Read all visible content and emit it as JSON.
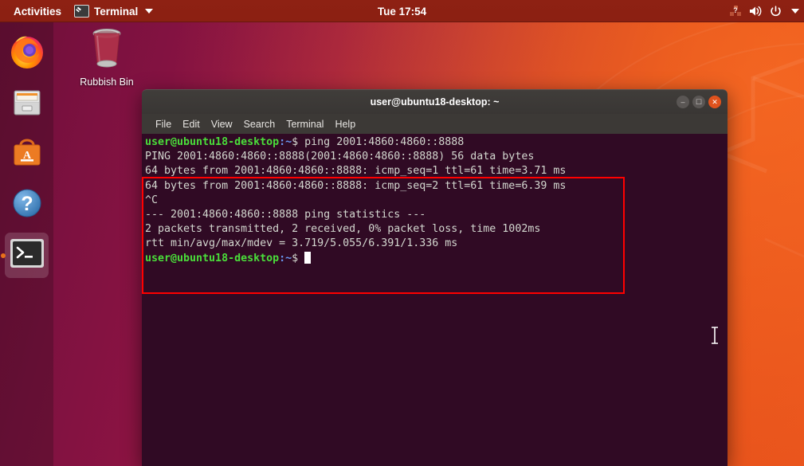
{
  "top_panel": {
    "activities_label": "Activities",
    "app_menu_label": "Terminal",
    "app_menu_icon": "terminal-icon",
    "clock": "Tue 17:54",
    "system_icons": [
      "keyboard-layout-icon",
      "volume-icon",
      "power-icon",
      "chevron-down-icon"
    ]
  },
  "dock": {
    "items": [
      {
        "name": "firefox",
        "label": "Firefox Web Browser",
        "active": false
      },
      {
        "name": "files",
        "label": "Files",
        "active": false
      },
      {
        "name": "ubuntu-software",
        "label": "Ubuntu Software",
        "active": false
      },
      {
        "name": "help",
        "label": "Help",
        "active": false
      },
      {
        "name": "terminal",
        "label": "Terminal",
        "active": true
      }
    ]
  },
  "desktop": {
    "icons": [
      {
        "name": "rubbish-bin",
        "label": "Rubbish Bin"
      }
    ]
  },
  "terminal_window": {
    "title": "user@ubuntu18-desktop: ~",
    "window_buttons": {
      "minimize": "–",
      "maximize": "☐",
      "close": "✕"
    },
    "menus": [
      "File",
      "Edit",
      "View",
      "Search",
      "Terminal",
      "Help"
    ],
    "prompt": {
      "user_host": "user@ubuntu18-desktop",
      "path": ":~",
      "symbol": "$"
    },
    "command": " ping 2001:4860:4860::8888",
    "output_lines": [
      "PING 2001:4860:4860::8888(2001:4860:4860::8888) 56 data bytes",
      "64 bytes from 2001:4860:4860::8888: icmp_seq=1 ttl=61 time=3.71 ms",
      "64 bytes from 2001:4860:4860::8888: icmp_seq=2 ttl=61 time=6.39 ms",
      "^C",
      "--- 2001:4860:4860::8888 ping statistics ---",
      "2 packets transmitted, 2 received, 0% packet loss, time 1002ms",
      "rtt min/avg/max/mdev = 3.719/5.055/6.391/1.336 ms"
    ]
  },
  "annotation": {
    "type": "rectangle",
    "color": "#ff0000"
  },
  "colors": {
    "terminal_bg": "#300a24",
    "panel_bg": "#8b2012",
    "accent_orange": "#e8521c",
    "prompt_green": "#4ade3a",
    "prompt_blue": "#6a96f0",
    "annotation_red": "#ff0000"
  }
}
